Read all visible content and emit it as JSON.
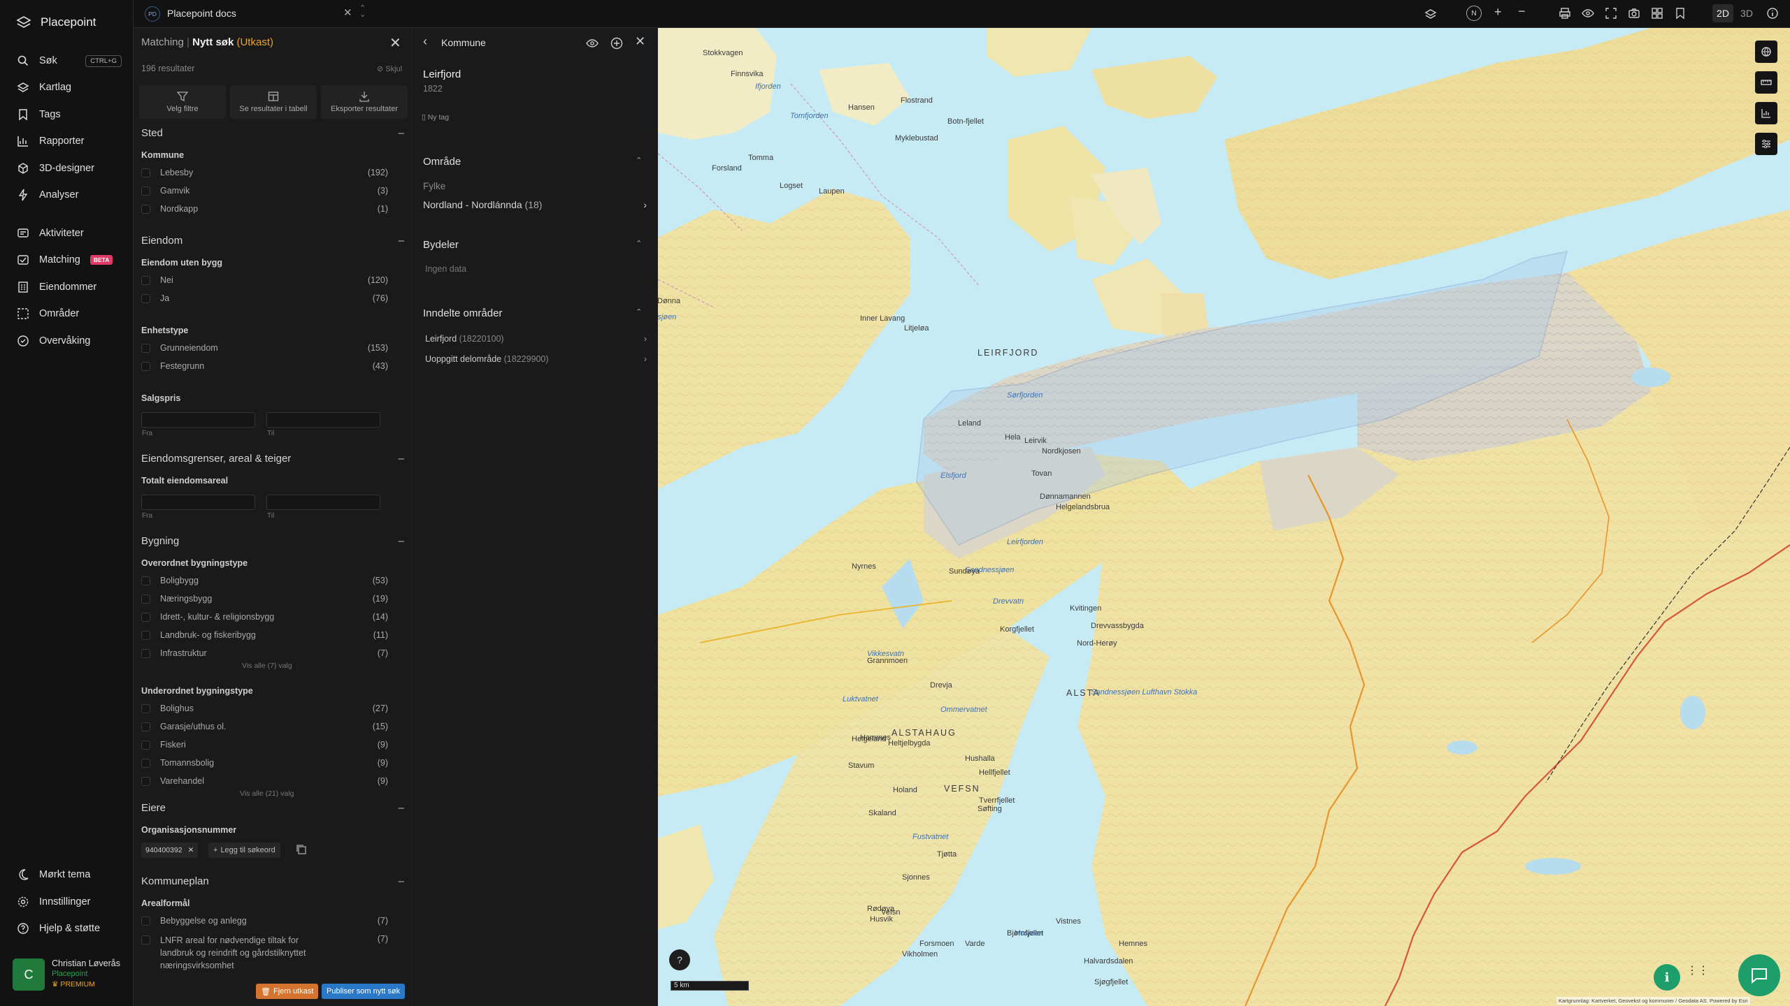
{
  "app": {
    "brand": "Placepoint",
    "workspace_badge": "PD",
    "workspace": "Placepoint docs"
  },
  "sidebar": {
    "items": [
      {
        "label": "Søk",
        "shortcut": "CTRL+G"
      },
      {
        "label": "Kartlag"
      },
      {
        "label": "Tags"
      },
      {
        "label": "Rapporter"
      },
      {
        "label": "3D-designer"
      },
      {
        "label": "Analyser"
      },
      {
        "label": "Aktiviteter"
      },
      {
        "label": "Matching",
        "badge": "BETA"
      },
      {
        "label": "Eiendommer"
      },
      {
        "label": "Områder"
      },
      {
        "label": "Overvåking"
      }
    ],
    "bottom": [
      {
        "label": "Mørkt tema"
      },
      {
        "label": "Innstillinger"
      },
      {
        "label": "Hjelp & støtte"
      }
    ],
    "user": {
      "initial": "C",
      "name": "Christian Løverås",
      "org": "Placepoint",
      "plan": "PREMIUM"
    }
  },
  "topbar": {
    "compass": "N",
    "mode_2d": "2D",
    "mode_3d": "3D"
  },
  "filter": {
    "crumb": "Matching",
    "title": "Nytt søk",
    "draft": "(Utkast)",
    "results": "196 resultater",
    "hide": "Skjul",
    "tools": [
      {
        "label": "Velg filtre"
      },
      {
        "label": "Se resultater i tabell"
      },
      {
        "label": "Eksporter resultater"
      }
    ],
    "sted": {
      "title": "Sted",
      "sub": "Kommune",
      "rows": [
        {
          "label": "Lebesby",
          "count": "(192)"
        },
        {
          "label": "Gamvik",
          "count": "(3)"
        },
        {
          "label": "Nordkapp",
          "count": "(1)"
        }
      ]
    },
    "eiendom": {
      "title": "Eiendom",
      "sub1": "Eiendom uten bygg",
      "rows1": [
        {
          "label": "Nei",
          "count": "(120)"
        },
        {
          "label": "Ja",
          "count": "(76)"
        }
      ],
      "sub2": "Enhetstype",
      "rows2": [
        {
          "label": "Grunneiendom",
          "count": "(153)"
        },
        {
          "label": "Festegrunn",
          "count": "(43)"
        }
      ],
      "sub3": "Salgspris",
      "from": "Fra",
      "to": "Til"
    },
    "grenser": {
      "title": "Eiendomsgrenser, areal & teiger",
      "sub": "Totalt eiendomsareal",
      "from": "Fra",
      "to": "Til"
    },
    "bygning": {
      "title": "Bygning",
      "sub1": "Overordnet bygningstype",
      "rows1": [
        {
          "label": "Boligbygg",
          "count": "(53)"
        },
        {
          "label": "Næringsbygg",
          "count": "(19)"
        },
        {
          "label": "Idrett-, kultur- & religionsbygg",
          "count": "(14)"
        },
        {
          "label": "Landbruk- og fiskeribygg",
          "count": "(11)"
        },
        {
          "label": "Infrastruktur",
          "count": "(7)"
        }
      ],
      "showall1": "Vis alle (7) valg",
      "sub2": "Underordnet bygningstype",
      "rows2": [
        {
          "label": "Bolighus",
          "count": "(27)"
        },
        {
          "label": "Garasje/uthus ol.",
          "count": "(15)"
        },
        {
          "label": "Fiskeri",
          "count": "(9)"
        },
        {
          "label": "Tomannsbolig",
          "count": "(9)"
        },
        {
          "label": "Varehandel",
          "count": "(9)"
        }
      ],
      "showall2": "Vis alle (21) valg"
    },
    "eiere": {
      "title": "Eiere",
      "sub": "Organisasjonsnummer",
      "chip": "940400392",
      "add": "Legg til søkeord"
    },
    "kommuneplan": {
      "title": "Kommuneplan",
      "sub": "Arealformål",
      "rows": [
        {
          "label": "Bebyggelse og anlegg",
          "count": "(7)"
        },
        {
          "label": "LNFR areal for nødvendige tiltak for landbruk og reindrift og gårdstilknyttet næringsvirksomhet",
          "count": "(7)"
        }
      ]
    },
    "remove": "Fjern utkast",
    "publish": "Publiser som nytt søk"
  },
  "kommune": {
    "header": "Kommune",
    "name": "Leirfjord",
    "code": "1822",
    "tag": "Ny tag",
    "omrade": "Område",
    "fylke_label": "Fylke",
    "fylke": "Nordland - Nordlánnda",
    "fylke_count": "(18)",
    "bydeler": "Bydeler",
    "ingen": "Ingen data",
    "inndelte": "Inndelte områder",
    "areas": [
      {
        "label": "Leirfjord",
        "code": "(18220100)"
      },
      {
        "label": "Uoppgitt delområde",
        "code": "(18229900)"
      }
    ]
  },
  "map": {
    "scale": "5 km",
    "attribution": "Kartgrunnlag: Kartverket, Geovekst og kommuner / Geodata AS. Powered by Esri",
    "places": [
      {
        "t": "Stokkvagen"
      },
      {
        "t": "Finnsvika"
      },
      {
        "t": "Ifjorden"
      },
      {
        "t": "Hansen"
      },
      {
        "t": "Flostrand"
      },
      {
        "t": "Botn-fjellet"
      },
      {
        "t": "Tomfjorden"
      },
      {
        "t": "Nordøværfjorden"
      },
      {
        "t": "SJONA"
      },
      {
        "t": "NESNA"
      },
      {
        "t": "Handnesøya"
      },
      {
        "t": "Myklebustad"
      },
      {
        "t": "Tomma"
      },
      {
        "t": "Forsland"
      },
      {
        "t": "Logset"
      },
      {
        "t": "Laupen"
      },
      {
        "t": "DØNNA"
      },
      {
        "t": "Husby"
      },
      {
        "t": "Dannes"
      },
      {
        "t": "Nesna"
      },
      {
        "t": "Hugla"
      },
      {
        "t": "Stavseng"
      },
      {
        "t": "Skipsfjorden"
      },
      {
        "t": "Lekta"
      },
      {
        "t": "Sandåker"
      },
      {
        "t": "Bardals-sjøen"
      },
      {
        "t": "Hestnes-fjellet"
      },
      {
        "t": "Hemnes-berget"
      },
      {
        "t": "Levika"
      },
      {
        "t": "Dønna"
      },
      {
        "t": "Solfjellsjøen"
      },
      {
        "t": "Inner Lavang"
      },
      {
        "t": "Litjeløa"
      },
      {
        "t": "LEIRFJORD"
      },
      {
        "t": "Sørfjorden"
      },
      {
        "t": "Hela"
      },
      {
        "t": "Leland"
      },
      {
        "t": "Leirvik"
      },
      {
        "t": "Nordkjosen"
      },
      {
        "t": "Tovan"
      },
      {
        "t": "Elsfjord"
      },
      {
        "t": "Dønnamannen"
      },
      {
        "t": "Helgelandsbrua"
      },
      {
        "t": "Leirfjorden"
      },
      {
        "t": "Sandnessjøen"
      },
      {
        "t": "Kvitingen"
      },
      {
        "t": "Drevvassbygda"
      },
      {
        "t": "Drevvatn"
      },
      {
        "t": "Korgfjellet"
      },
      {
        "t": "Nord-Herøy"
      },
      {
        "t": "Alstenfjorden"
      },
      {
        "t": "Nyrnes"
      },
      {
        "t": "Sundøya"
      },
      {
        "t": "ALSTA"
      },
      {
        "t": "Sandnessjøen Lufthavn Stokka"
      },
      {
        "t": "Vefsnfjorden"
      },
      {
        "t": "Remsneset"
      },
      {
        "t": "Åkvik"
      },
      {
        "t": "Vikkesvatn"
      },
      {
        "t": "Grannmoen"
      },
      {
        "t": "Drevja"
      },
      {
        "t": "Ommervatnet"
      },
      {
        "t": "Luktvatnet"
      },
      {
        "t": "ALSTAHAUG"
      },
      {
        "t": "Hammes"
      },
      {
        "t": "Hushalla"
      },
      {
        "t": "Hellfjellet"
      },
      {
        "t": "VEFSN"
      },
      {
        "t": "Tverrfjellet"
      },
      {
        "t": "Helgeland"
      },
      {
        "t": "Heltjelbygda"
      },
      {
        "t": "Stavum"
      },
      {
        "t": "Holand"
      },
      {
        "t": "Søfting"
      },
      {
        "t": "Skaland"
      },
      {
        "t": "Fustvatnet"
      },
      {
        "t": "Tjøtta"
      },
      {
        "t": "Sjonnes"
      },
      {
        "t": "Rødøya"
      },
      {
        "t": "Husvik"
      },
      {
        "t": "Vikholmen"
      },
      {
        "t": "Vefsn"
      },
      {
        "t": "Forsmoen"
      },
      {
        "t": "Varde"
      },
      {
        "t": "Mosjøen"
      },
      {
        "t": "Halvardsdalen"
      },
      {
        "t": "Sjøgfjellet"
      },
      {
        "t": "Bjørnfjellet"
      },
      {
        "t": "Vistnes"
      },
      {
        "t": "Hemnes"
      }
    ]
  }
}
